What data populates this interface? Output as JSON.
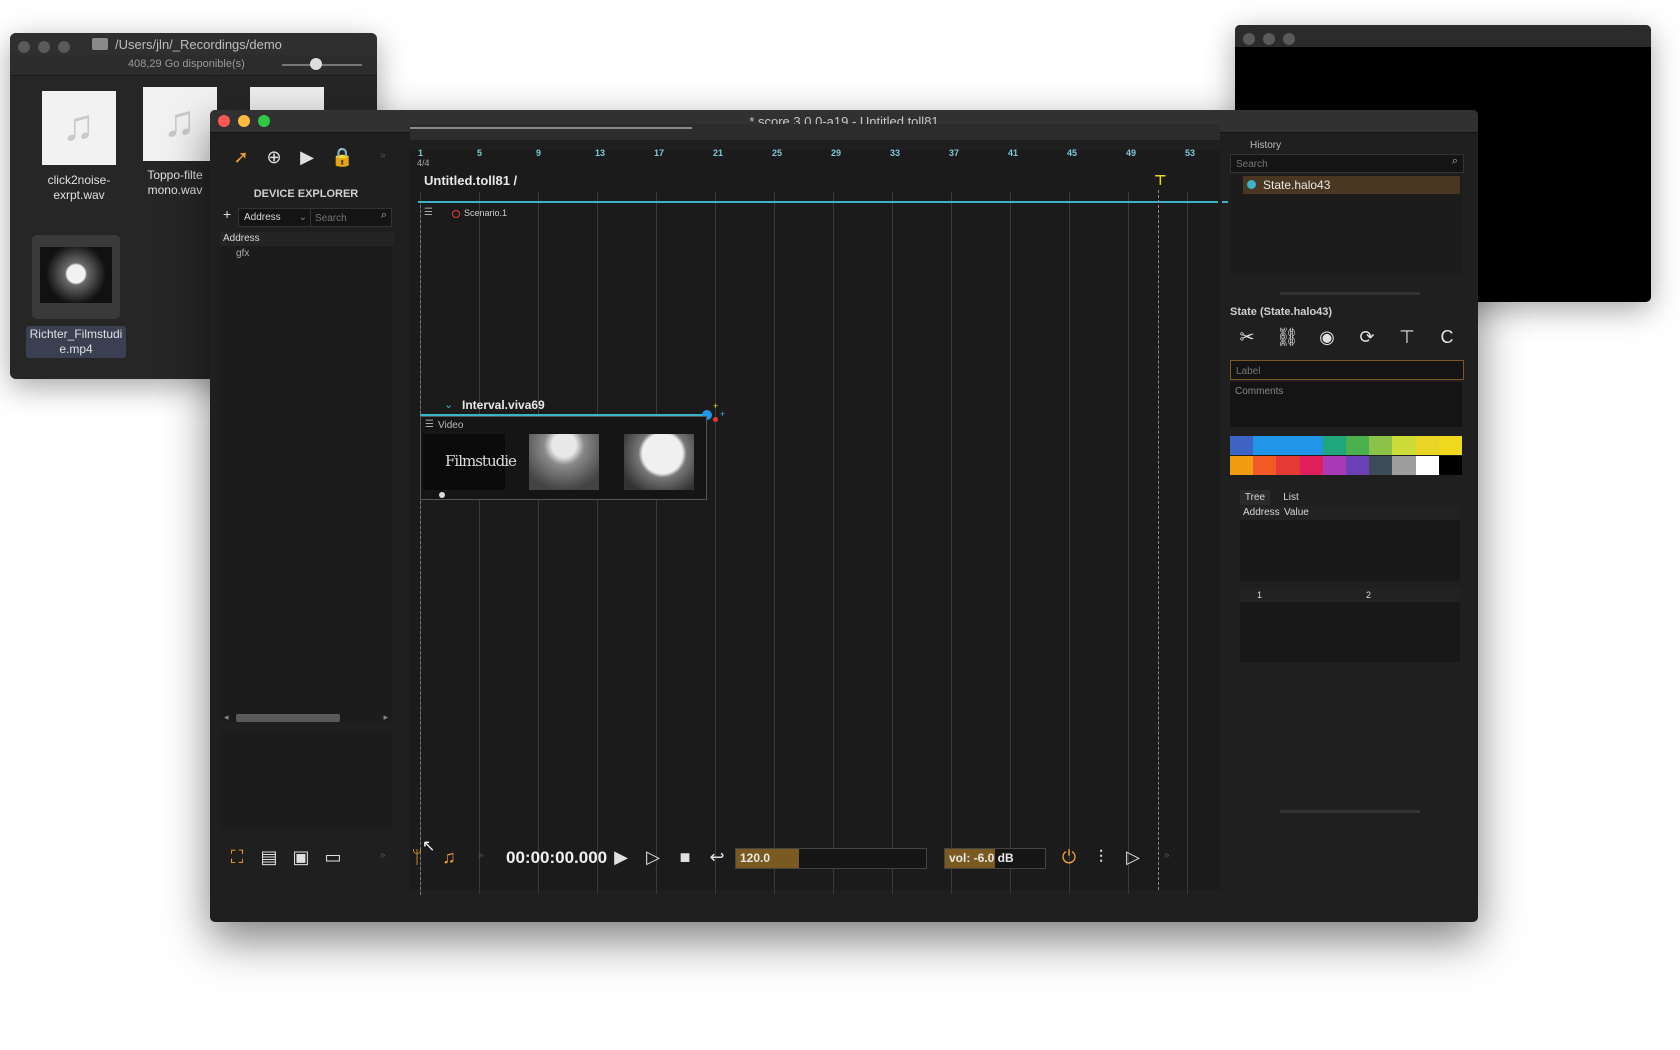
{
  "finder": {
    "path": "/Users/jln/_Recordings/demo",
    "status": "408,29 Go disponible(s)",
    "files": [
      {
        "name_line1": "click2noise-",
        "name_line2": "exrpt.wav"
      },
      {
        "name_line1": "Toppo-filte",
        "name_line2": "mono.wav"
      },
      {
        "name_line1": "Richter_Filmstudi",
        "name_line2": "e.mp4"
      }
    ]
  },
  "main": {
    "title": "* score 3.0.0-a19 - Untitled.toll81"
  },
  "device_explorer": {
    "heading": "DEVICE EXPLORER",
    "add_label": "+",
    "address_select": "Address",
    "search_placeholder": "Search",
    "column_header": "Address",
    "tree_items": [
      "gfx"
    ]
  },
  "timeline": {
    "ruler": [
      "1",
      "5",
      "9",
      "13",
      "17",
      "21",
      "25",
      "29",
      "33",
      "37",
      "41",
      "45",
      "49",
      "53"
    ],
    "time_signature": "4/4",
    "breadcrumb": "Untitled.toll81 /",
    "scenario_label": "Scenario.1",
    "interval_label": "Interval.viva69",
    "process_label": "Video",
    "thumb_text": "Filmstudie"
  },
  "transport": {
    "time": "00:00:00.000",
    "tempo": "120.0",
    "tempo_fraction": 0.33,
    "volume": "vol: -6.0 dB",
    "volume_fraction": 0.5
  },
  "history": {
    "title": "History",
    "search_placeholder": "Search",
    "items": [
      "State.halo43"
    ]
  },
  "inspector": {
    "title": "State (State.halo43)",
    "label_placeholder": "Label",
    "comments_placeholder": "Comments",
    "tabs": [
      "Tree",
      "List"
    ],
    "table_headers": [
      "Address",
      "Value"
    ],
    "sub_headers": [
      "1",
      "2"
    ],
    "colors": {
      "row1": [
        "#3d63c4",
        "#2196e8",
        "#2196e8",
        "#2196e8",
        "#1fa77b",
        "#4bb14f",
        "#8bc34a",
        "#cddc39",
        "#e8d525",
        "#f0d81d"
      ],
      "row2": [
        "#f39c12",
        "#f15a24",
        "#e53935",
        "#e01e5a",
        "#a83bb5",
        "#6b3fb6",
        "#3e4c59",
        "#9e9e9e",
        "#ffffff",
        "#000000"
      ]
    }
  },
  "colors": {
    "accent_orange": "#f0a030",
    "accent_cyan": "#3cb4c8",
    "history_selected": "#4a3722"
  }
}
